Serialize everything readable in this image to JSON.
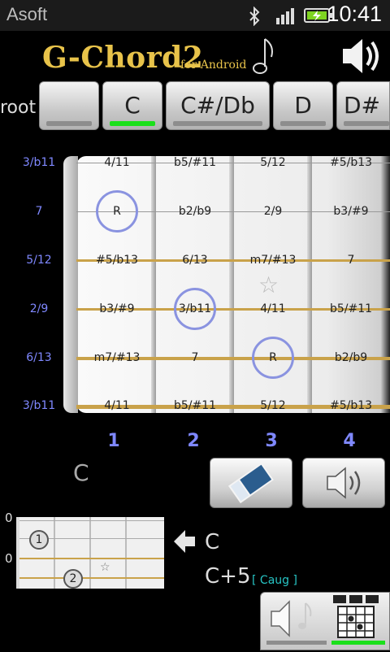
{
  "status_bar": {
    "app_name": "Asoft",
    "time": "10:41"
  },
  "header": {
    "title": "G-Chord2",
    "subtitle": "for Android"
  },
  "root": {
    "label": "root",
    "buttons": [
      {
        "label": ""
      },
      {
        "label": "C"
      },
      {
        "label": "C#/Db"
      },
      {
        "label": "D"
      },
      {
        "label": "D#"
      }
    ]
  },
  "fretboard": {
    "row_labels": [
      "3/b11",
      "7",
      "5/12",
      "2/9",
      "6/13",
      "3/b11"
    ],
    "rows": [
      [
        "4/11",
        "b5/#11",
        "5/12",
        "#5/b13"
      ],
      [
        "R",
        "b2/b9",
        "2/9",
        "b3/#9"
      ],
      [
        "#5/b13",
        "6/13",
        "m7/#13",
        "7"
      ],
      [
        "b3/#9",
        "3/b11",
        "4/11",
        "b5/#11"
      ],
      [
        "m7/#13",
        "7",
        "R",
        "b2/b9"
      ],
      [
        "4/11",
        "b5/#11",
        "5/12",
        "#5/b13"
      ]
    ],
    "fret_numbers": [
      "1",
      "2",
      "3",
      "4"
    ]
  },
  "chord": {
    "current_name": "C"
  },
  "mini_diagram": {
    "fret_labels": [
      "0",
      "0"
    ],
    "dot1": "1",
    "dot2": "2",
    "star": "☆"
  },
  "results": {
    "primary": "C",
    "secondary": "C+5",
    "secondary_alias": "[ Caug ]"
  },
  "colors": {
    "accent_green": "#1be01b",
    "gold": "#e8c34a",
    "interval_blue": "#7f88ff",
    "ring": "#8a93e0"
  }
}
